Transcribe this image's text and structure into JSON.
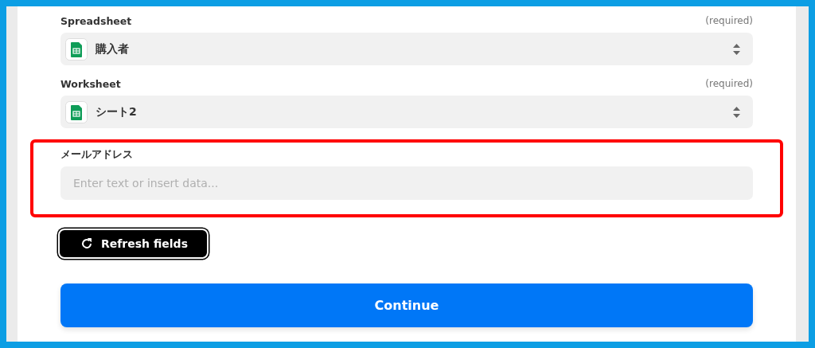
{
  "fields": [
    {
      "kind": "select",
      "label": "Spreadsheet",
      "note": "(required)",
      "value": "購入者",
      "highlighted": false
    },
    {
      "kind": "select",
      "label": "Worksheet",
      "note": "(required)",
      "value": "シート2",
      "highlighted": false
    },
    {
      "kind": "text",
      "label": "メールアドレス",
      "placeholder": "Enter text or insert data...",
      "highlighted": true
    }
  ],
  "refresh_button": "Refresh fields",
  "continue_button": "Continue"
}
